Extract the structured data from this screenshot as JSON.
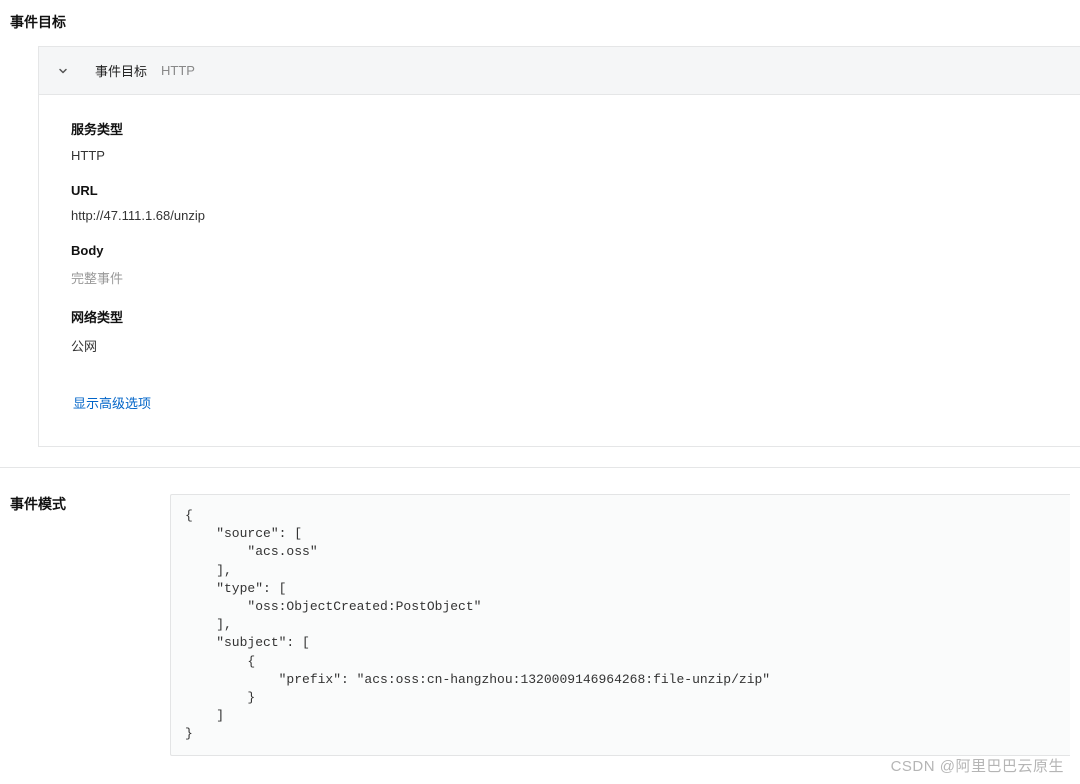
{
  "target": {
    "section_title": "事件目标",
    "header_label": "事件目标",
    "header_subtype": "HTTP",
    "fields": {
      "service_type": {
        "label": "服务类型",
        "value": "HTTP"
      },
      "url": {
        "label": "URL",
        "value": "http://47.111.1.68/unzip"
      },
      "body": {
        "label": "Body",
        "value": "完整事件"
      },
      "network": {
        "label": "网络类型",
        "value": "公网"
      }
    },
    "advanced_link": "显示高级选项"
  },
  "pattern": {
    "section_title": "事件模式",
    "code": "{\n    \"source\": [\n        \"acs.oss\"\n    ],\n    \"type\": [\n        \"oss:ObjectCreated:PostObject\"\n    ],\n    \"subject\": [\n        {\n            \"prefix\": \"acs:oss:cn-hangzhou:1320009146964268:file-unzip/zip\"\n        }\n    ]\n}"
  },
  "watermark": "CSDN @阿里巴巴云原生"
}
